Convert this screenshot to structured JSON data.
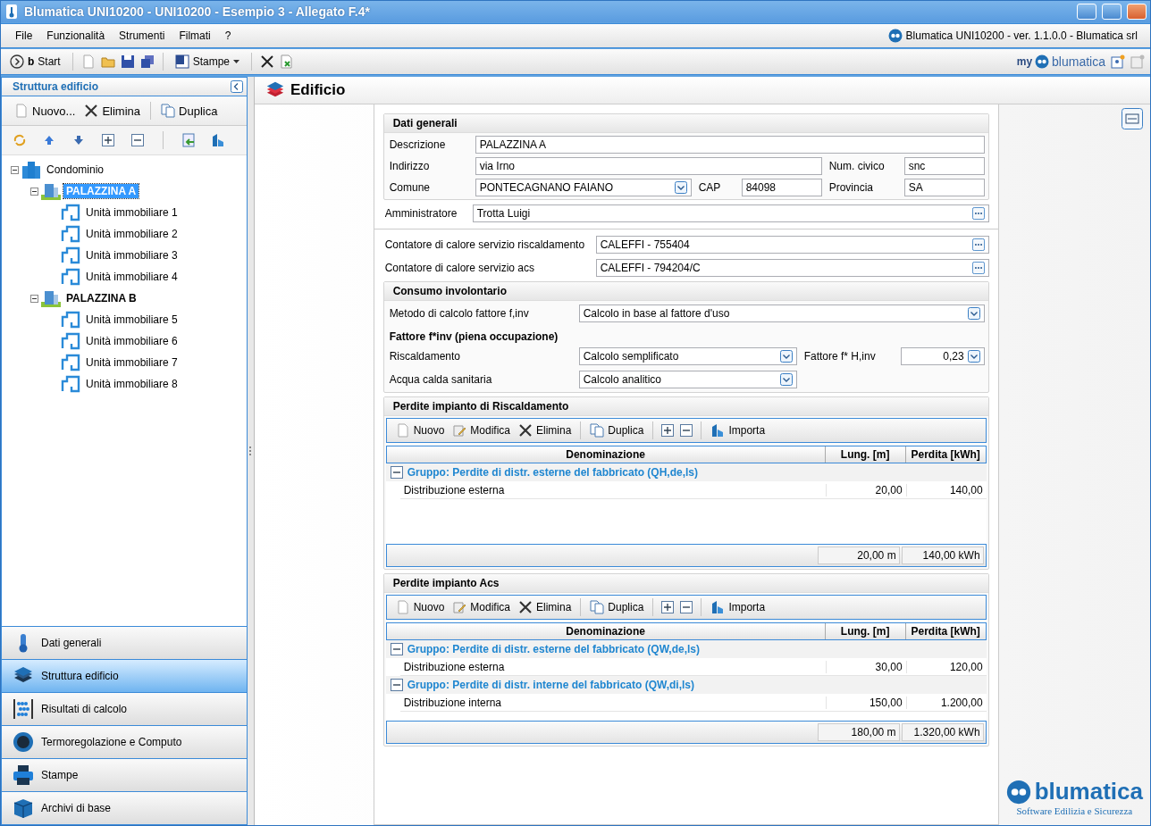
{
  "window": {
    "title": "Blumatica UNI10200 - UNI10200 - Esempio 3 - Allegato F.4*"
  },
  "menu": {
    "items": [
      "File",
      "Funzionalità",
      "Strumenti",
      "Filmati",
      "?"
    ],
    "app_info": "Blumatica UNI10200 - ver. 1.1.0.0 - Blumatica srl"
  },
  "toolbar": {
    "start": "**b**Start",
    "print": "Stampe"
  },
  "brand": {
    "prefix": "my",
    "name": "blumatica"
  },
  "sidebar": {
    "title": "Struttura edificio",
    "actions": [
      {
        "label": "Nuovo...",
        "kind": "new"
      },
      {
        "label": "Elimina",
        "kind": "delete"
      },
      {
        "label": "Duplica",
        "kind": "copy"
      }
    ],
    "tree": [
      {
        "label": "Condominio",
        "kind": "complex",
        "selected": false,
        "expanded": true,
        "children": [
          {
            "label": "PALAZZINA A",
            "kind": "building",
            "selected": true,
            "expanded": true,
            "children": [
              {
                "label": "Unità immobiliare 1",
                "kind": "unit",
                "selected": false
              },
              {
                "label": "Unità immobiliare 2",
                "kind": "unit",
                "selected": false
              },
              {
                "label": "Unità immobiliare 3",
                "kind": "unit",
                "selected": false
              },
              {
                "label": "Unità immobiliare 4",
                "kind": "unit",
                "selected": false
              }
            ]
          },
          {
            "label": "PALAZZINA B",
            "kind": "building",
            "selected": false,
            "expanded": true,
            "children": [
              {
                "label": "Unità immobiliare 5",
                "kind": "unit",
                "selected": false
              },
              {
                "label": "Unità immobiliare 6",
                "kind": "unit",
                "selected": false
              },
              {
                "label": "Unità immobiliare 7",
                "kind": "unit",
                "selected": false
              },
              {
                "label": "Unità immobiliare 8",
                "kind": "unit",
                "selected": false
              }
            ]
          }
        ]
      }
    ]
  },
  "nav": [
    {
      "label": "Dati generali",
      "kind": "thermometer",
      "selected": false
    },
    {
      "label": "Struttura edificio",
      "kind": "layers",
      "selected": true
    },
    {
      "label": "Risultati di calcolo",
      "kind": "abacus",
      "selected": false
    },
    {
      "label": "Termoregolazione e Computo",
      "kind": "gauge",
      "selected": false
    },
    {
      "label": "Stampe",
      "kind": "printer",
      "selected": false
    },
    {
      "label": "Archivi di base",
      "kind": "box",
      "selected": false
    }
  ],
  "page": {
    "title": "Edificio"
  },
  "dati_generali": {
    "title": "Dati generali",
    "descrizione": {
      "label": "Descrizione",
      "value": "PALAZZINA A"
    },
    "indirizzo": {
      "label": "Indirizzo",
      "value": "via Irno"
    },
    "num_civico": {
      "label": "Num. civico",
      "value": "snc"
    },
    "comune": {
      "label": "Comune",
      "value": "PONTECAGNANO FAIANO"
    },
    "cap": {
      "label": "CAP",
      "value": "84098"
    },
    "provincia": {
      "label": "Provincia",
      "value": "SA"
    }
  },
  "amministratore": {
    "label": "Amministratore",
    "value": "Trotta Luigi"
  },
  "contatori": [
    {
      "label": "Contatore di calore servizio riscaldamento",
      "value": "CALEFFI - 755404"
    },
    {
      "label": "Contatore di calore servizio acs",
      "value": "CALEFFI - 794204/C"
    }
  ],
  "consumo": {
    "title": "Consumo involontario",
    "metodo": {
      "label": "Metodo di calcolo fattore f,inv",
      "value": "Calcolo in base al fattore d'uso"
    },
    "subtitle": "Fattore f*inv (piena occupazione)",
    "riscaldamento": {
      "label": "Riscaldamento",
      "value": "Calcolo semplificato"
    },
    "fattore": {
      "label": "Fattore f* H,inv",
      "value": "0,23"
    },
    "acs": {
      "label": "Acqua calda sanitaria",
      "value": "Calcolo analitico"
    }
  },
  "perdite": [
    {
      "title": "Perdite impianto di Riscaldamento",
      "actions": [
        {
          "label": "Nuovo",
          "kind": "new"
        },
        {
          "label": "Modifica",
          "kind": "edit"
        },
        {
          "label": "Elimina",
          "kind": "delete"
        },
        {
          "label": "Duplica",
          "kind": "copy"
        },
        {
          "kind": "expand"
        },
        {
          "kind": "collapse"
        },
        {
          "label": "Importa",
          "kind": "import"
        }
      ],
      "columns": [
        "Denominazione",
        "Lung. [m]",
        "Perdita [kWh]"
      ],
      "groups": [
        {
          "title": "Gruppo: Perdite di distr. esterne del fabbricato (QH,de,ls)",
          "expanded": true,
          "rows": [
            [
              "Distribuzione esterna",
              "20,00",
              "140,00"
            ]
          ]
        }
      ],
      "totals": [
        "20,00 m",
        "140,00 kWh"
      ]
    },
    {
      "title": "Perdite impianto Acs",
      "actions": [
        {
          "label": "Nuovo",
          "kind": "new"
        },
        {
          "label": "Modifica",
          "kind": "edit"
        },
        {
          "label": "Elimina",
          "kind": "delete"
        },
        {
          "label": "Duplica",
          "kind": "copy"
        },
        {
          "kind": "expand"
        },
        {
          "kind": "collapse"
        },
        {
          "label": "Importa",
          "kind": "import"
        }
      ],
      "columns": [
        "Denominazione",
        "Lung. [m]",
        "Perdita [kWh]"
      ],
      "groups": [
        {
          "title": "Gruppo: Perdite di distr. esterne del fabbricato (QW,de,ls)",
          "expanded": true,
          "rows": [
            [
              "Distribuzione esterna",
              "30,00",
              "120,00"
            ]
          ]
        },
        {
          "title": "Gruppo: Perdite di distr. interne del fabbricato (QW,di,ls)",
          "expanded": true,
          "rows": [
            [
              "Distribuzione interna",
              "150,00",
              "1.200,00"
            ]
          ]
        }
      ],
      "totals": [
        "180,00 m",
        "1.320,00 kWh"
      ]
    }
  ],
  "footer_logo": {
    "name": "blumatica",
    "tagline": "Software Edilizia e Sicurezza"
  }
}
